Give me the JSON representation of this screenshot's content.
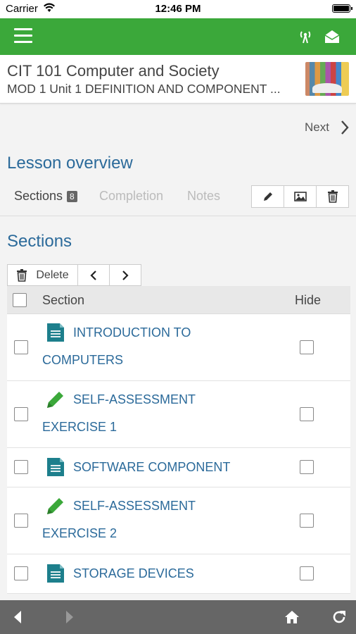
{
  "status_bar": {
    "carrier": "Carrier",
    "time": "12:46 PM"
  },
  "app_bar": {
    "menu_icon": "hamburger-menu-icon",
    "right_icons": [
      "antenna-icon",
      "mail-icon"
    ]
  },
  "course": {
    "title": "CIT 101 Computer and Society",
    "subtitle": "MOD 1 Unit 1 DEFINITION AND COMPONENT ..."
  },
  "navigation": {
    "next_label": "Next"
  },
  "lesson": {
    "heading": "Lesson overview"
  },
  "tabs": [
    {
      "label": "Sections",
      "badge": "8",
      "active": true
    },
    {
      "label": "Completion",
      "active": false
    },
    {
      "label": "Notes",
      "active": false
    }
  ],
  "toolbar_icons": [
    "pencil-icon",
    "image-icon",
    "trash-icon"
  ],
  "sections": {
    "heading": "Sections",
    "delete_label": "Delete",
    "columns": {
      "section": "Section",
      "hide": "Hide"
    },
    "rows": [
      {
        "line1": "INTRODUCTION TO",
        "line2": "COMPUTERS",
        "icon": "document-icon"
      },
      {
        "line1": "SELF-ASSESSMENT",
        "line2": "EXERCISE 1",
        "icon": "pencil-icon"
      },
      {
        "line1": "SOFTWARE COMPONENT",
        "line2": "",
        "icon": "document-icon"
      },
      {
        "line1": "SELF-ASSESSMENT",
        "line2": "EXERCISE 2",
        "icon": "pencil-icon"
      },
      {
        "line1": "STORAGE DEVICES",
        "line2": "",
        "icon": "document-icon"
      }
    ]
  },
  "bottom_bar": {
    "icons": [
      "back-arrow-icon",
      "forward-arrow-icon",
      "home-icon",
      "refresh-icon"
    ]
  },
  "colors": {
    "app_bar": "#3ba83a",
    "link": "#2b6a9a",
    "doc_icon": "#1d7f8c",
    "pencil_icon": "#3ba83a",
    "bottom_bar": "#666666"
  }
}
